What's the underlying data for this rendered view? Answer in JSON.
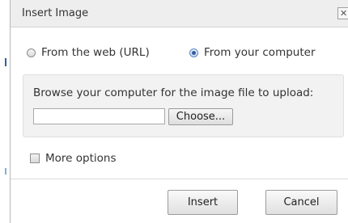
{
  "dialog": {
    "title": "Insert Image",
    "close_label": "✕"
  },
  "source": {
    "options": [
      {
        "label": "From the web (URL)",
        "selected": false
      },
      {
        "label": "From your computer",
        "selected": true
      }
    ]
  },
  "upload": {
    "prompt": "Browse your computer for the image file to upload:",
    "file_value": "",
    "choose_label": "Choose..."
  },
  "more_options": {
    "label": "More options",
    "checked": false
  },
  "footer": {
    "insert_label": "Insert",
    "cancel_label": "Cancel"
  },
  "colors": {
    "titlebar": "#eeeeee",
    "panel": "#f2f2f2",
    "radio_selected": "#2f5fa0"
  }
}
